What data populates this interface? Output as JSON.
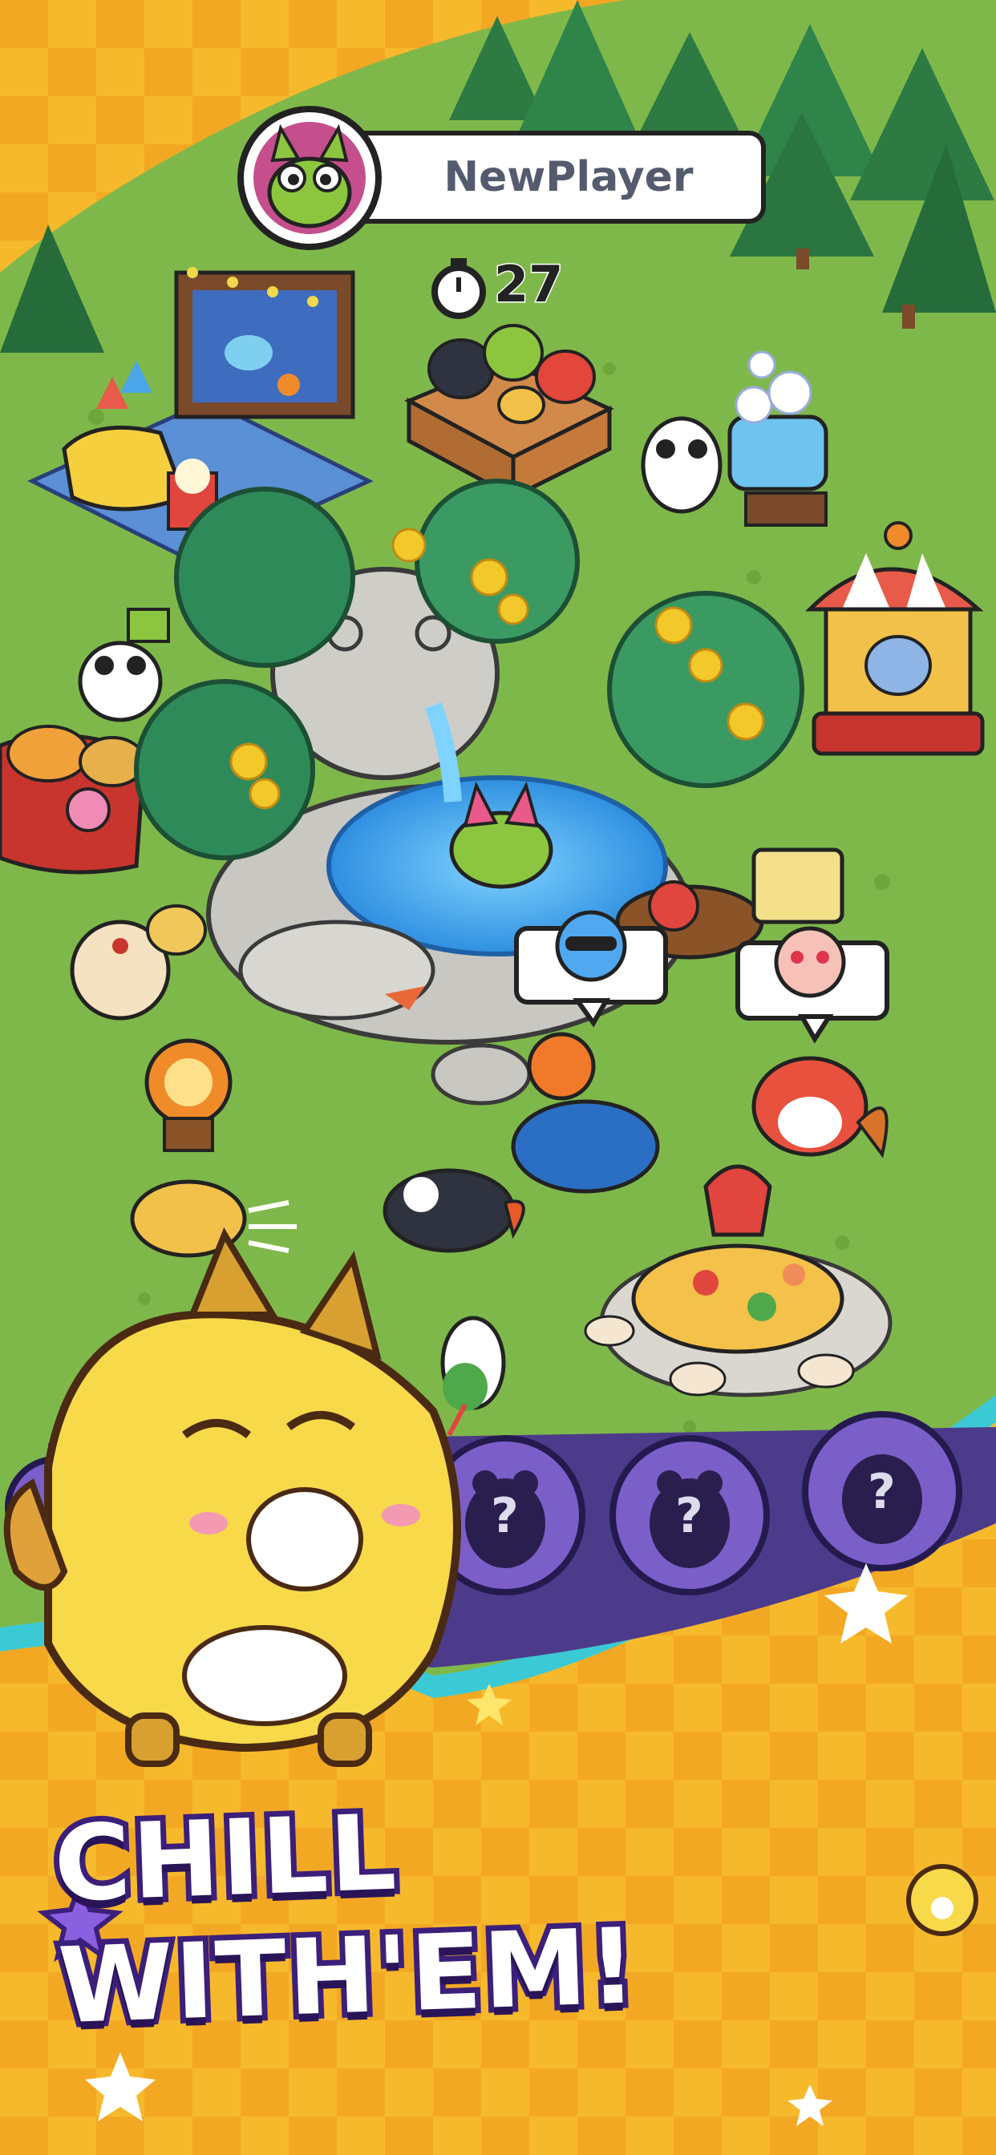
{
  "player": {
    "name": "NewPlayer",
    "avatar": "green-frog-cat-avatar"
  },
  "timer": {
    "icon": "stopwatch-icon",
    "value": "27"
  },
  "emotes": [
    {
      "icon": "cool-sunglasses-face-icon"
    },
    {
      "icon": "heart-eyes-face-icon"
    }
  ],
  "collection_slots": [
    {
      "state": "locked",
      "label": "?"
    },
    {
      "state": "locked",
      "label": "?"
    },
    {
      "state": "locked",
      "label": "?"
    }
  ],
  "headline": "CHILL WITH'EM!",
  "colors": {
    "grass": "#7fb84a",
    "banner_yellow": "#f5b52a",
    "teal_border": "#3cc9d6",
    "slot_purple": "#7a5fc9",
    "text_outline": "#3b1f7a"
  }
}
